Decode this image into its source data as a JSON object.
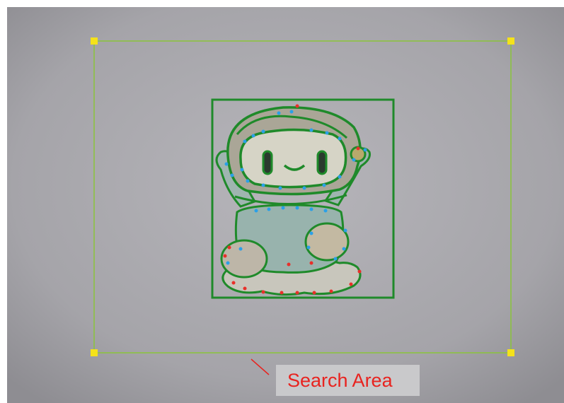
{
  "annotation": {
    "label": "Search Area",
    "label_color": "#e8231f"
  },
  "colors": {
    "region_outline": "#8ac43a",
    "handle": "#f5e21a",
    "match_outline": "#1f8a2a",
    "feature_inlier": "#2aa0e8",
    "feature_outlier": "#e8302a",
    "background": "#a9a8ad"
  },
  "icons": {
    "handles": "square-handle-icon",
    "arrow": "arrow-icon"
  }
}
